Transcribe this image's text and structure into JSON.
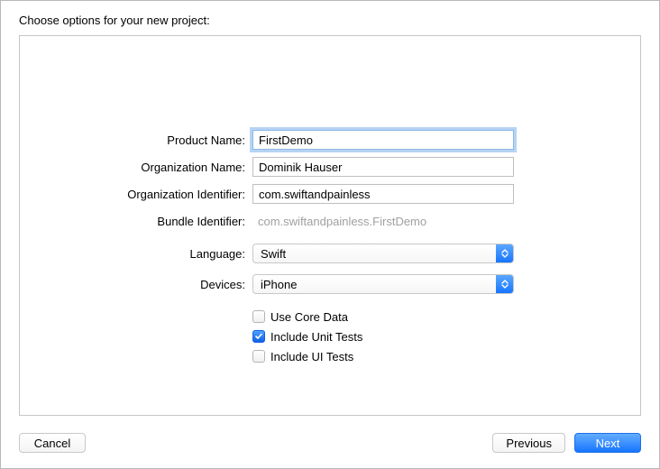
{
  "title": "Choose options for your new project:",
  "labels": {
    "productName": "Product Name:",
    "organizationName": "Organization Name:",
    "organizationIdentifier": "Organization Identifier:",
    "bundleIdentifier": "Bundle Identifier:",
    "language": "Language:",
    "devices": "Devices:"
  },
  "fields": {
    "productName": "FirstDemo",
    "organizationName": "Dominik Hauser",
    "organizationIdentifier": "com.swiftandpainless",
    "bundleIdentifier": "com.swiftandpainless.FirstDemo",
    "language": "Swift",
    "devices": "iPhone"
  },
  "checkboxes": {
    "useCoreData": {
      "label": "Use Core Data",
      "checked": false
    },
    "includeUnitTests": {
      "label": "Include Unit Tests",
      "checked": true
    },
    "includeUITests": {
      "label": "Include UI Tests",
      "checked": false
    }
  },
  "buttons": {
    "cancel": "Cancel",
    "previous": "Previous",
    "next": "Next"
  }
}
